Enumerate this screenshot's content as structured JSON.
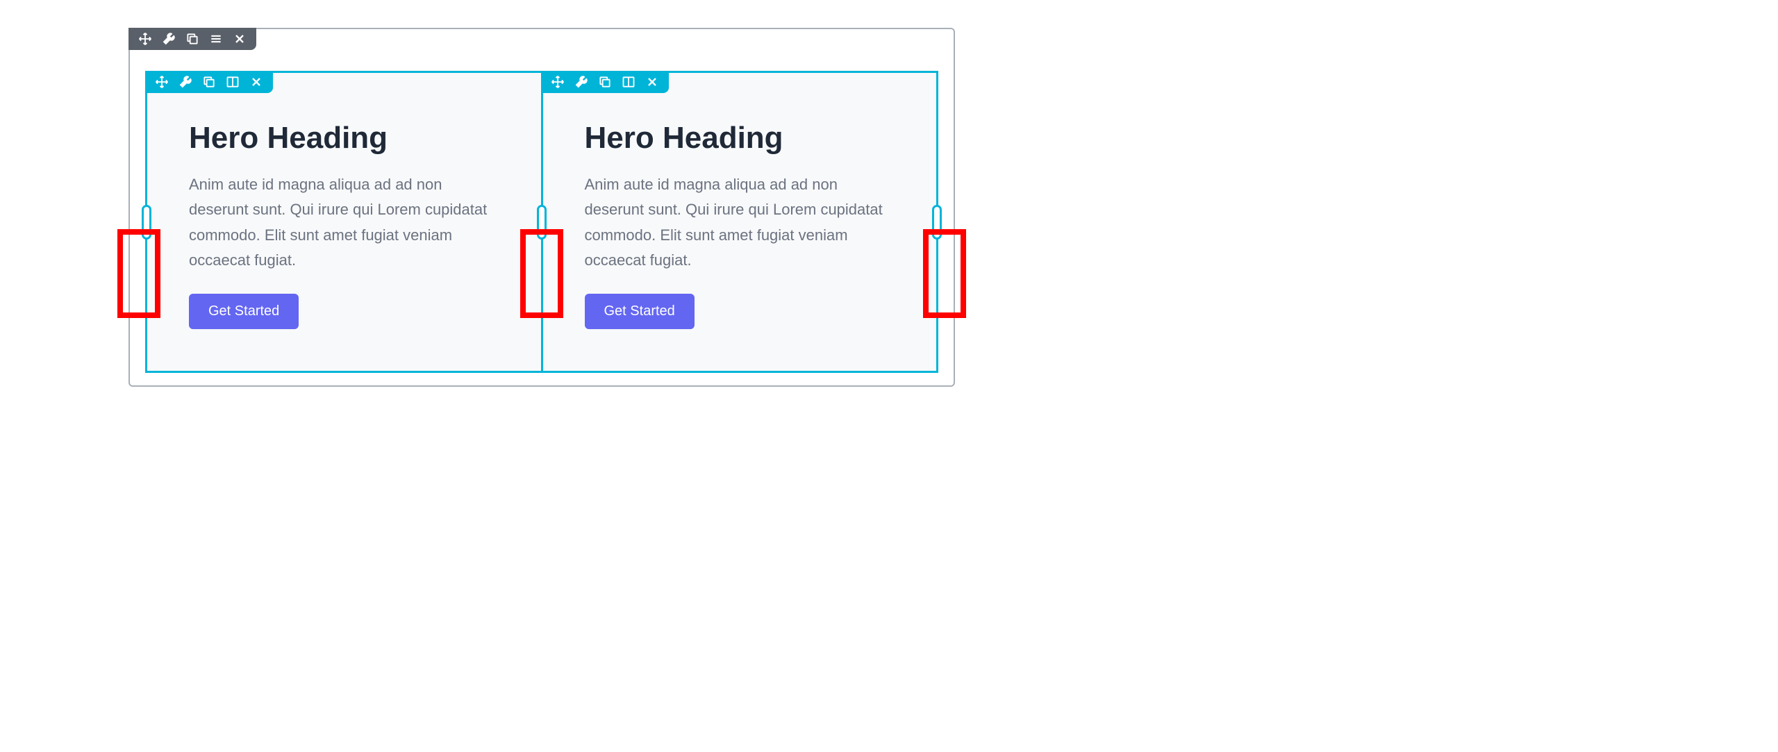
{
  "colors": {
    "outer_toolbar_bg": "#5a6069",
    "column_accent": "#00b4d8",
    "cta_bg": "#6366f1",
    "highlight": "#ff0000"
  },
  "outer_toolbar": {
    "icons": [
      "move",
      "wrench",
      "duplicate",
      "menu",
      "close"
    ]
  },
  "column_toolbar": {
    "icons": [
      "move",
      "wrench",
      "duplicate",
      "columns",
      "close"
    ]
  },
  "columns": [
    {
      "heading": "Hero Heading",
      "body": "Anim aute id magna aliqua ad ad non deserunt sunt. Qui irure qui Lorem cupidatat commodo. Elit sunt amet fugiat veniam occaecat fugiat.",
      "cta_label": "Get Started"
    },
    {
      "heading": "Hero Heading",
      "body": "Anim aute id magna aliqua ad ad non deserunt sunt. Qui irure qui Lorem cupidatat commodo. Elit sunt amet fugiat veniam occaecat fugiat.",
      "cta_label": "Get Started"
    }
  ],
  "resize_handles": [
    "left",
    "middle",
    "right"
  ],
  "highlight_positions": [
    "left",
    "middle",
    "right"
  ]
}
